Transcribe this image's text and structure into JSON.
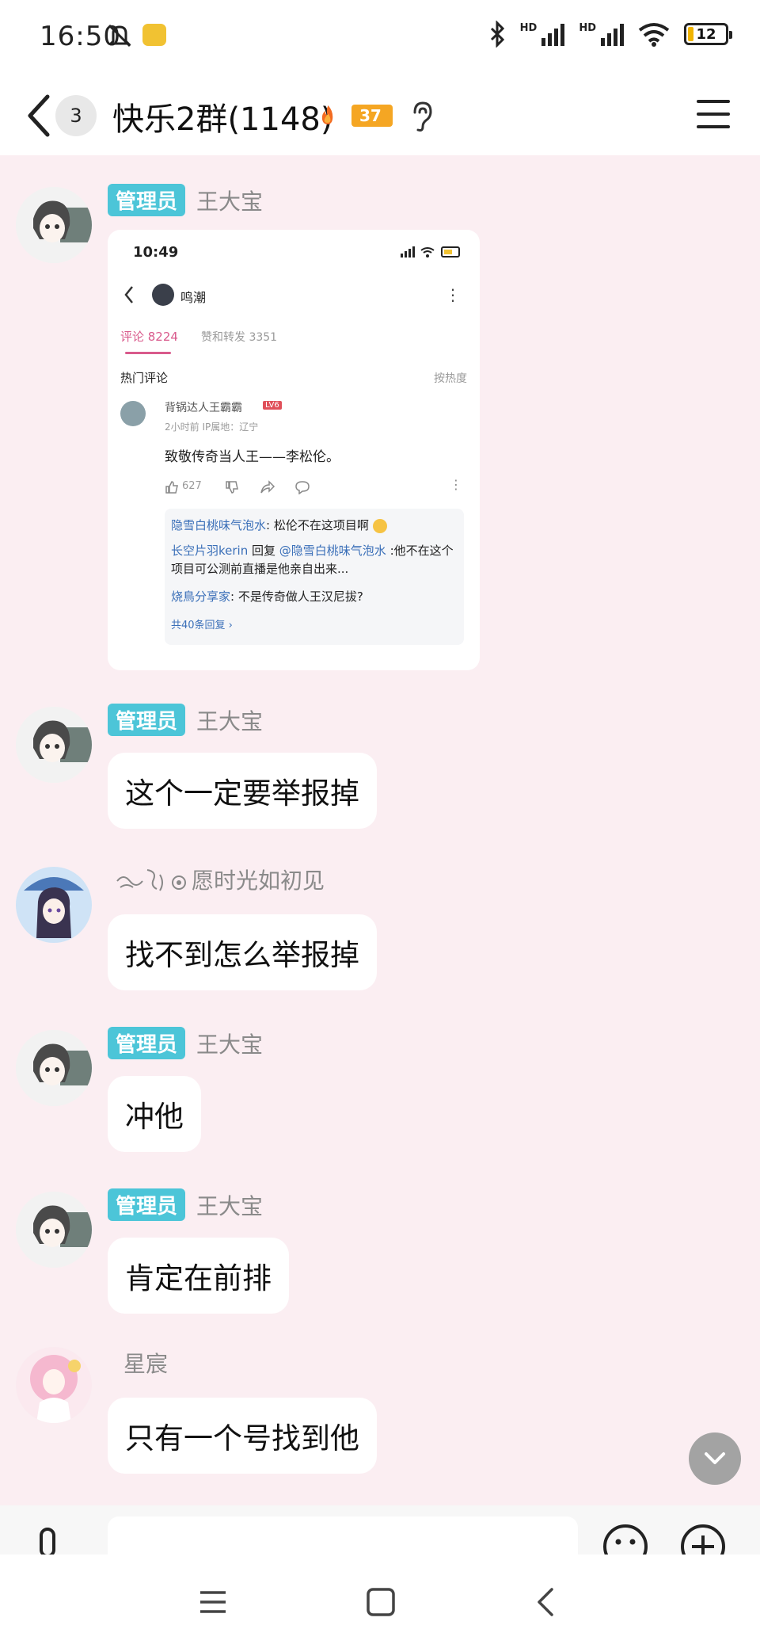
{
  "status_bar": {
    "time": "16:50",
    "battery": "12",
    "signal_label_1": "HD",
    "signal_label_2": "HD"
  },
  "header": {
    "unread_count": "3",
    "title": "快乐2群(1148)",
    "fire_level": "37"
  },
  "messages": [
    {
      "sender": "王大宝",
      "role": "管理员",
      "type": "image",
      "screenshot": {
        "time": "10:49",
        "author": "鸣潮",
        "tab_comments": "评论 8224",
        "tab_likes": "赞和转发 3351",
        "section": "热门评论",
        "sort": "按热度",
        "commenter": "背锅达人王霸霸",
        "commenter_badge": "LV6",
        "meta": "2小时前  IP属地：辽宁",
        "comment": "致敬传奇当人王——李松伦。",
        "like_count": "627",
        "replies": [
          {
            "user": "隐雪白桃味气泡水",
            "text": ": 松伦不在这项目啊"
          },
          {
            "user": "长空片羽kerin",
            "text": " 回复 ",
            "mention": "@隐雪白桃味气泡水",
            "tail": " :他不在这个项目可公测前直播是他亲自出来..."
          },
          {
            "user": "烧鳥分享家",
            "text": ": 不是传奇做人王汉尼拔?"
          }
        ],
        "more_replies": "共40条回复 ›"
      }
    },
    {
      "sender": "王大宝",
      "role": "管理员",
      "text": "这个一定要举报掉"
    },
    {
      "sender": "愿时光如初见",
      "role": "",
      "text": "找不到怎么举报掉"
    },
    {
      "sender": "王大宝",
      "role": "管理员",
      "text": "冲他"
    },
    {
      "sender": "王大宝",
      "role": "管理员",
      "text": "肯定在前排"
    },
    {
      "sender": "星宸",
      "role": "",
      "text": "只有一个号找到他"
    }
  ],
  "icons": {
    "back": "chevron-left-icon",
    "menu": "hamburger-menu-icon",
    "ear": "ear-icon",
    "scroll": "chevron-down-icon",
    "mic": "microphone-icon",
    "emoji": "emoji-icon",
    "add": "plus-icon",
    "nav_menu": "menu-lines-icon",
    "nav_home": "square-home-icon",
    "nav_back": "back-triangle-icon"
  },
  "colors": {
    "chat_background": "#fbeef2",
    "role_tag": "#4cc5d8",
    "fire": "#f5a623"
  }
}
